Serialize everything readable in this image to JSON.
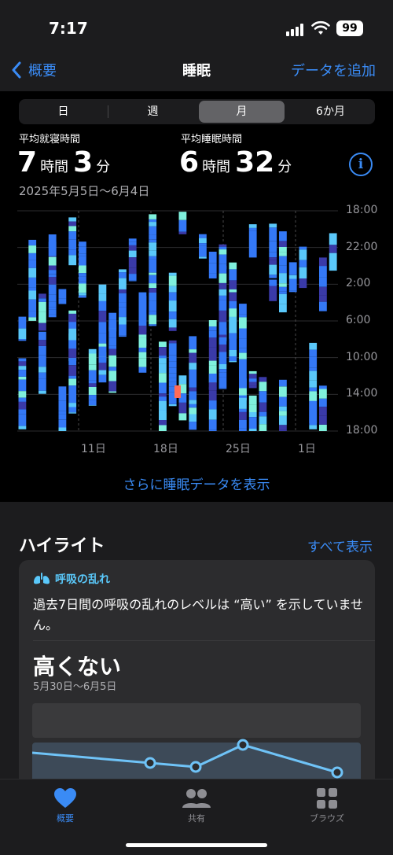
{
  "status": {
    "time": "7:17",
    "battery": "99"
  },
  "nav": {
    "back_label": "概要",
    "title": "睡眠",
    "add_label": "データを追加"
  },
  "segments": [
    "日",
    "週",
    "月",
    "6か月"
  ],
  "selected_segment": "月",
  "stats": {
    "bedtime_label": "平均就寝時間",
    "bedtime_h": "7",
    "bedtime_h_unit": "時間",
    "bedtime_m": "3",
    "bedtime_m_unit": "分",
    "sleep_label": "平均睡眠時間",
    "sleep_h": "6",
    "sleep_h_unit": "時間",
    "sleep_m": "32",
    "sleep_m_unit": "分",
    "date_range": "2025年5月5日〜6月4日"
  },
  "chart_data": {
    "type": "bar",
    "y_ticks": [
      "18:00",
      "22:00",
      "2:00",
      "6:00",
      "10:00",
      "14:00",
      "18:00"
    ],
    "x_ticks": [
      "11日",
      "18日",
      "25日",
      "1日"
    ],
    "stage_colors": {
      "awake": "#ff6b57",
      "rem": "#5ac8fa",
      "core": "#3478f6",
      "deep": "#3a3aa8",
      "in_bed": "#7ff0dd"
    }
  },
  "more_link": "さらに睡眠データを表示",
  "highlights": {
    "title": "ハイライト",
    "show_all": "すべて表示",
    "card": {
      "category": "呼吸の乱れ",
      "message": "過去7日間の呼吸の乱れのレベルは “高い” を示していません。",
      "value": "高くない",
      "date_range": "5月30日〜6月5日"
    }
  },
  "tabs": [
    {
      "label": "概要",
      "icon": "heart-icon"
    },
    {
      "label": "共有",
      "icon": "people-icon"
    },
    {
      "label": "ブラウズ",
      "icon": "grid-icon"
    }
  ],
  "colors": {
    "accent": "#3a8bf5",
    "background": "#000000",
    "card": "#2c2c2e"
  }
}
